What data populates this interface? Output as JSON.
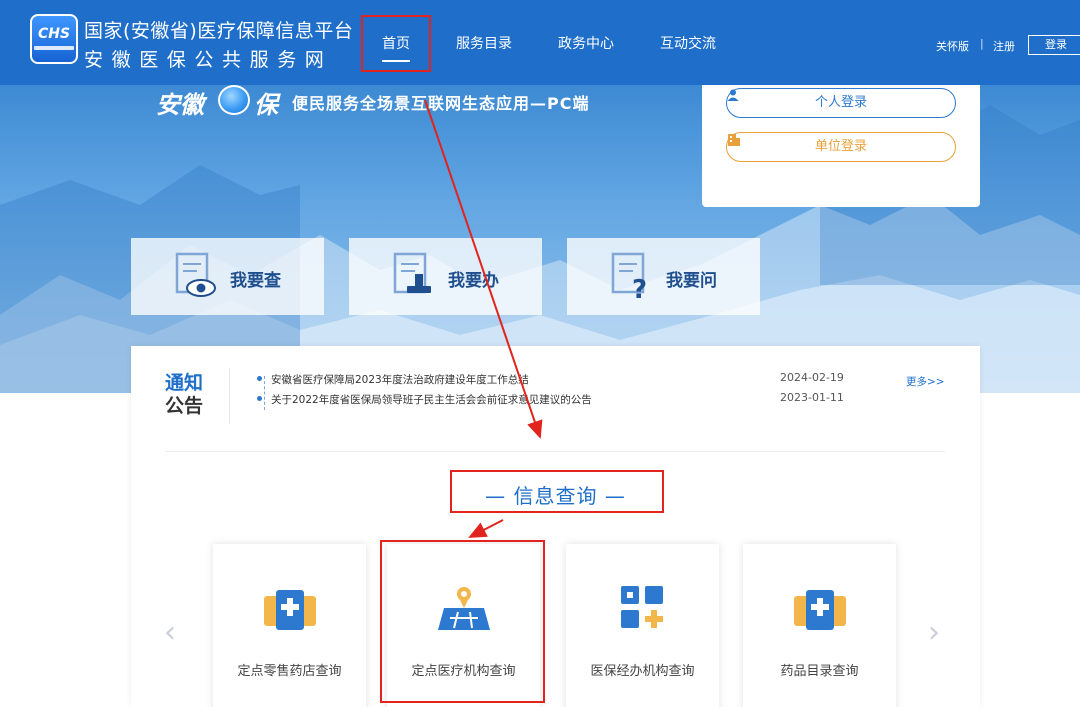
{
  "header": {
    "logo_text": "CHS",
    "title": "国家(安徽省)医疗保障信息平台",
    "subtitle": "安徽医保公共服务网",
    "nav": [
      "首页",
      "服务目录",
      "政务中心",
      "互动交流"
    ],
    "elder_mode": "关怀版",
    "separator": "|",
    "register": "注册",
    "login": "登录"
  },
  "hero": {
    "brand_left": "安徽",
    "brand_right": "保",
    "tagline": "便民服务全场景互联网生态应用—PC端",
    "personal_login": "个人登录",
    "unit_login": "单位登录",
    "quick_links": [
      "我要查",
      "我要办",
      "我要问"
    ]
  },
  "notice": {
    "title_line1": "通知",
    "title_line2": "公告",
    "items": [
      {
        "text": "安徽省医疗保障局2023年度法治政府建设年度工作总结",
        "date": "2024-02-19"
      },
      {
        "text": "关于2022年度省医保局领导班子民主生活会会前征求意见建议的公告",
        "date": "2023-01-11"
      }
    ],
    "more": "更多>>"
  },
  "info_query": {
    "title": "— 信息查询 —",
    "prev": "‹",
    "next": "›",
    "services": [
      {
        "label": "定点零售药店查询",
        "icon": "pharmacy-icon"
      },
      {
        "label": "定点医疗机构查询",
        "icon": "map-pin-icon"
      },
      {
        "label": "医保经办机构查询",
        "icon": "grid-plus-icon"
      },
      {
        "label": "药品目录查询",
        "icon": "medicine-box-icon"
      }
    ]
  },
  "colors": {
    "header_blue": "#1f6fca",
    "accent_orange": "#e9a23b",
    "annotation_red": "#e1241d"
  }
}
